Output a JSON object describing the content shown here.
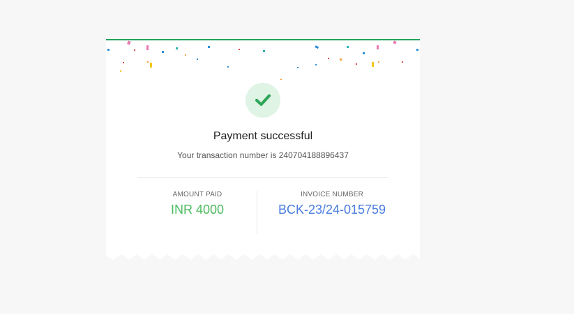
{
  "receipt": {
    "title": "Payment successful",
    "transaction_text": "Your transaction number is 240704188896437",
    "amount": {
      "label": "AMOUNT PAID",
      "value": "INR 4000",
      "color": "#4cbb5f"
    },
    "invoice": {
      "label": "INVOICE NUMBER",
      "value": "BCK-23/24-015759",
      "color": "#4a7de0"
    }
  },
  "colors": {
    "accent_bar": "#22a35a",
    "check_bg": "#dff4e4",
    "check_mark": "#2ea55a"
  },
  "icons": {
    "status": "check-icon",
    "decoration": "confetti"
  }
}
